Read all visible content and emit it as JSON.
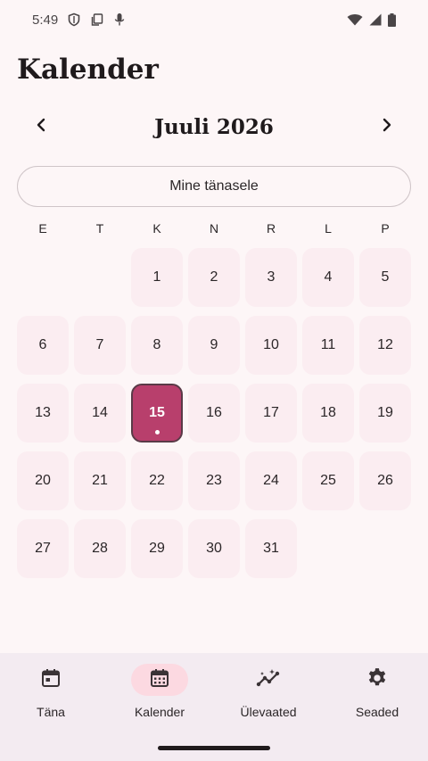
{
  "status_bar": {
    "time": "5:49",
    "icons_left": [
      "shield-icon",
      "copy-icon",
      "mic-icon"
    ],
    "icons_right": [
      "wifi-icon",
      "signal-icon",
      "battery-icon"
    ]
  },
  "page": {
    "title": "Kalender"
  },
  "calendar": {
    "month_label": "Juuli 2026",
    "prev_icon": "chevron-left-icon",
    "next_icon": "chevron-right-icon",
    "today_button": "Mine tänasele",
    "weekdays": [
      "E",
      "T",
      "K",
      "N",
      "R",
      "L",
      "P"
    ],
    "leading_blanks": 2,
    "days": [
      "1",
      "2",
      "3",
      "4",
      "5",
      "6",
      "7",
      "8",
      "9",
      "10",
      "11",
      "12",
      "13",
      "14",
      "15",
      "16",
      "17",
      "18",
      "19",
      "20",
      "21",
      "22",
      "23",
      "24",
      "25",
      "26",
      "27",
      "28",
      "29",
      "30",
      "31"
    ],
    "selected_day": "15",
    "accent_color": "#b83f6c"
  },
  "bottom_nav": {
    "items": [
      {
        "label": "Täna",
        "icon": "calendar-today-icon",
        "active": false
      },
      {
        "label": "Kalender",
        "icon": "calendar-month-icon",
        "active": true
      },
      {
        "label": "Ülevaated",
        "icon": "insights-icon",
        "active": false
      },
      {
        "label": "Seaded",
        "icon": "gear-icon",
        "active": false
      }
    ]
  }
}
